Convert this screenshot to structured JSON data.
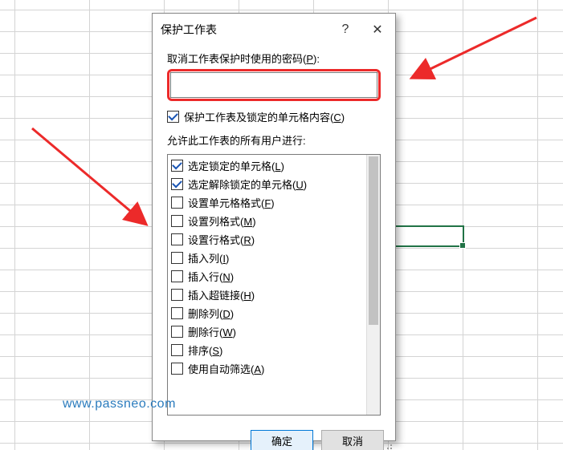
{
  "dialog": {
    "title": "保护工作表",
    "help": "?",
    "close": "✕",
    "password_label_pre": "取消工作表保护时使用的密码(",
    "password_label_u": "P",
    "password_label_post": "):",
    "password_value": "",
    "protect_cb_pre": "保护工作表及锁定的单元格内容(",
    "protect_cb_u": "C",
    "protect_cb_post": ")",
    "allow_label": "允许此工作表的所有用户进行:",
    "options": [
      {
        "checked": true,
        "pre": "选定锁定的单元格(",
        "u": "L",
        "post": ")"
      },
      {
        "checked": true,
        "pre": "选定解除锁定的单元格(",
        "u": "U",
        "post": ")"
      },
      {
        "checked": false,
        "pre": "设置单元格格式(",
        "u": "F",
        "post": ")"
      },
      {
        "checked": false,
        "pre": "设置列格式(",
        "u": "M",
        "post": ")"
      },
      {
        "checked": false,
        "pre": "设置行格式(",
        "u": "R",
        "post": ")"
      },
      {
        "checked": false,
        "pre": "插入列(",
        "u": "I",
        "post": ")"
      },
      {
        "checked": false,
        "pre": "插入行(",
        "u": "N",
        "post": ")"
      },
      {
        "checked": false,
        "pre": "插入超链接(",
        "u": "H",
        "post": ")"
      },
      {
        "checked": false,
        "pre": "删除列(",
        "u": "D",
        "post": ")"
      },
      {
        "checked": false,
        "pre": "删除行(",
        "u": "W",
        "post": ")"
      },
      {
        "checked": false,
        "pre": "排序(",
        "u": "S",
        "post": ")"
      },
      {
        "checked": false,
        "pre": "使用自动筛选(",
        "u": "A",
        "post": ")"
      }
    ],
    "ok": "确定",
    "cancel": "取消"
  },
  "watermark": "www.passneo.com"
}
